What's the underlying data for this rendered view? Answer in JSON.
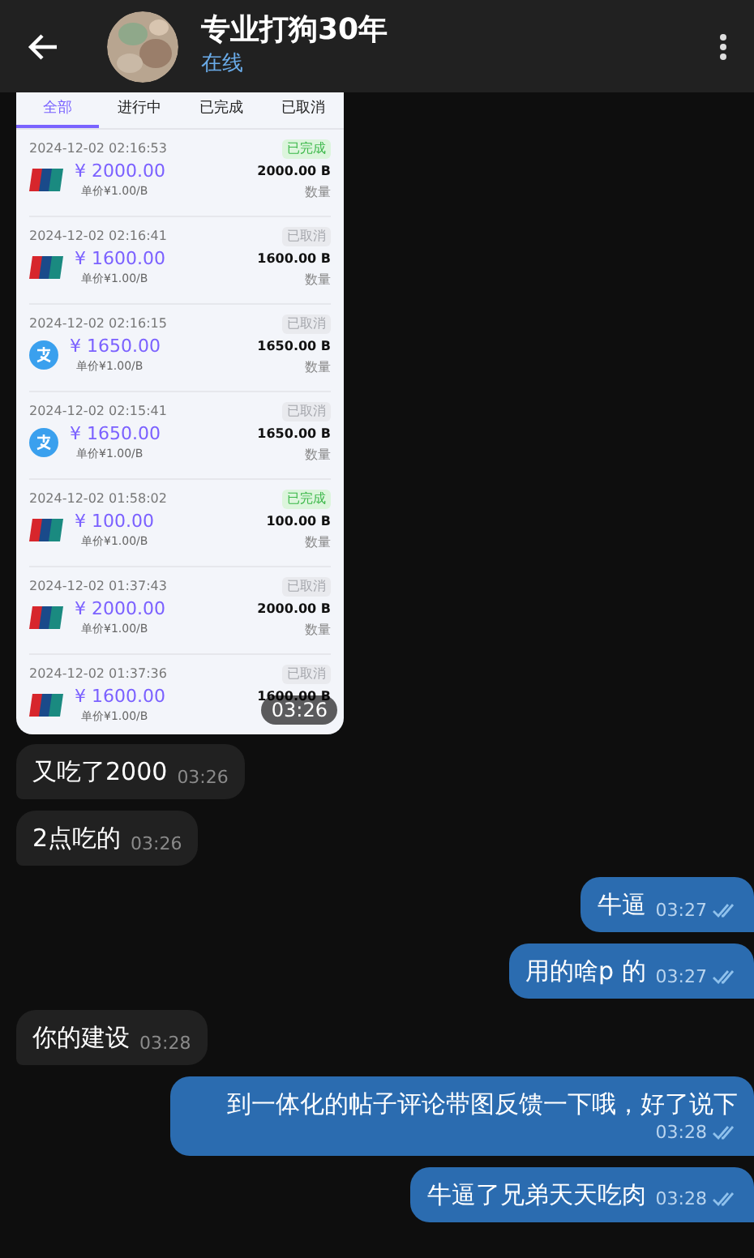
{
  "header": {
    "name": "专业打狗30年",
    "status": "在线"
  },
  "image_message": {
    "time": "03:26",
    "tabs": [
      {
        "label": "全部",
        "selected": true
      },
      {
        "label": "进行中",
        "selected": false
      },
      {
        "label": "已完成",
        "selected": false
      },
      {
        "label": "已取消",
        "selected": false
      }
    ],
    "orders": [
      {
        "time": "2024-12-02 02:16:53",
        "status": "已完成",
        "kind": "completed",
        "payment": {
          "kind": "unionpay"
        },
        "amount": "¥ 2000.00",
        "unit_price": "单价¥1.00/B",
        "quantity": "2000.00 B",
        "quantity_label": "数量"
      },
      {
        "time": "2024-12-02 02:16:41",
        "status": "已取消",
        "kind": "cancelled",
        "payment": {
          "kind": "unionpay"
        },
        "amount": "¥ 1600.00",
        "unit_price": "单价¥1.00/B",
        "quantity": "1600.00 B",
        "quantity_label": "数量"
      },
      {
        "time": "2024-12-02 02:16:15",
        "status": "已取消",
        "kind": "cancelled",
        "payment": {
          "kind": "alipay"
        },
        "amount": "¥ 1650.00",
        "unit_price": "单价¥1.00/B",
        "quantity": "1650.00 B",
        "quantity_label": "数量"
      },
      {
        "time": "2024-12-02 02:15:41",
        "status": "已取消",
        "kind": "cancelled",
        "payment": {
          "kind": "alipay"
        },
        "amount": "¥ 1650.00",
        "unit_price": "单价¥1.00/B",
        "quantity": "1650.00 B",
        "quantity_label": "数量"
      },
      {
        "time": "2024-12-02 01:58:02",
        "status": "已完成",
        "kind": "completed",
        "payment": {
          "kind": "unionpay"
        },
        "amount": "¥ 100.00",
        "unit_price": "单价¥1.00/B",
        "quantity": "100.00 B",
        "quantity_label": "数量"
      },
      {
        "time": "2024-12-02 01:37:43",
        "status": "已取消",
        "kind": "cancelled",
        "payment": {
          "kind": "unionpay"
        },
        "amount": "¥ 2000.00",
        "unit_price": "单价¥1.00/B",
        "quantity": "2000.00 B",
        "quantity_label": "数量"
      },
      {
        "time": "2024-12-02 01:37:36",
        "status": "已取消",
        "kind": "cancelled",
        "payment": {
          "kind": "unionpay"
        },
        "amount": "¥ 1600.00",
        "unit_price": "单价¥1.00/B",
        "quantity": "1600.00 B"
      }
    ]
  },
  "messages": [
    {
      "kind": "incoming",
      "text": "又吃了2000",
      "time": "03:26"
    },
    {
      "kind": "incoming",
      "text": "2点吃的",
      "time": "03:26"
    },
    {
      "kind": "outgoing",
      "text": "牛逼",
      "time": "03:27",
      "read": true
    },
    {
      "kind": "outgoing",
      "text": "用的啥p 的",
      "time": "03:27",
      "read": true
    },
    {
      "kind": "incoming",
      "text": "你的建设",
      "time": "03:28"
    },
    {
      "kind": "outgoing",
      "text": "到一体化的帖子评论带图反馈一下哦，好了说下",
      "time": "03:28",
      "read": true
    },
    {
      "kind": "outgoing",
      "text": "牛逼了兄弟天天吃肉",
      "time": "03:28",
      "read": true
    }
  ]
}
